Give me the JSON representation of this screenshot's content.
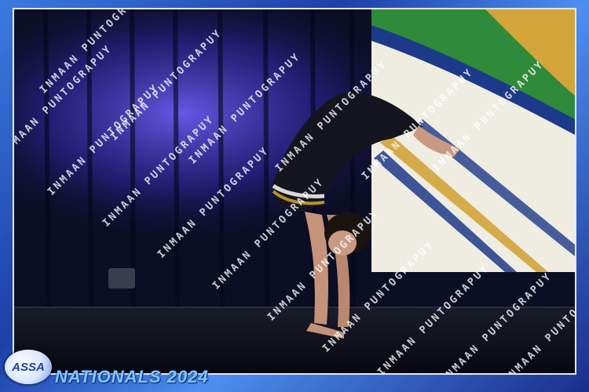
{
  "event": {
    "logo_text": "ASSA",
    "title": "NATIONALS 2024"
  },
  "watermark": {
    "line_a": "INMAAN PUNTOGRAPUY",
    "line_b": "INMAAN PUNTOGRAPUY"
  },
  "colors": {
    "frame_blue": "#2a5fd0",
    "curtain": "#10122e",
    "spotlight": "#5a4fd8",
    "banner_green": "#2f8a3a",
    "banner_gold": "#d2a43a",
    "title_color": "#7fc7ff"
  }
}
